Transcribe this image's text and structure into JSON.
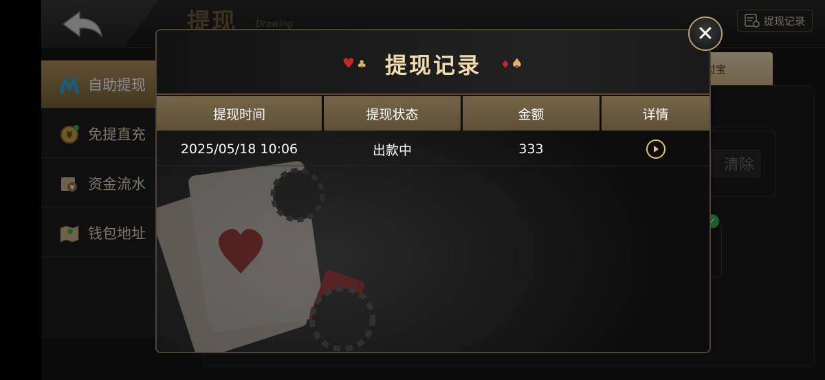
{
  "app": {
    "page_title": "提现",
    "page_title_sub": "Drawing",
    "record_button_label": "提现记录"
  },
  "sidebar": {
    "items": [
      {
        "label": "自助提现",
        "icon": "m-logo-icon",
        "active": true
      },
      {
        "label": "免提直充",
        "icon": "coin-icon",
        "active": false
      },
      {
        "label": "资金流水",
        "icon": "ledger-icon",
        "active": false
      },
      {
        "label": "钱包地址",
        "icon": "map-icon",
        "active": false
      }
    ]
  },
  "background": {
    "tab_alipay_label": "付宝",
    "clear_button_label": "清除"
  },
  "modal": {
    "title": "提现记录",
    "columns": [
      "提现时间",
      "提现状态",
      "金额",
      "详情"
    ],
    "rows": [
      {
        "time": "2025/05/18 10:06",
        "status": "出款中",
        "amount": "333"
      }
    ],
    "accent_color": "#e7c36e"
  }
}
